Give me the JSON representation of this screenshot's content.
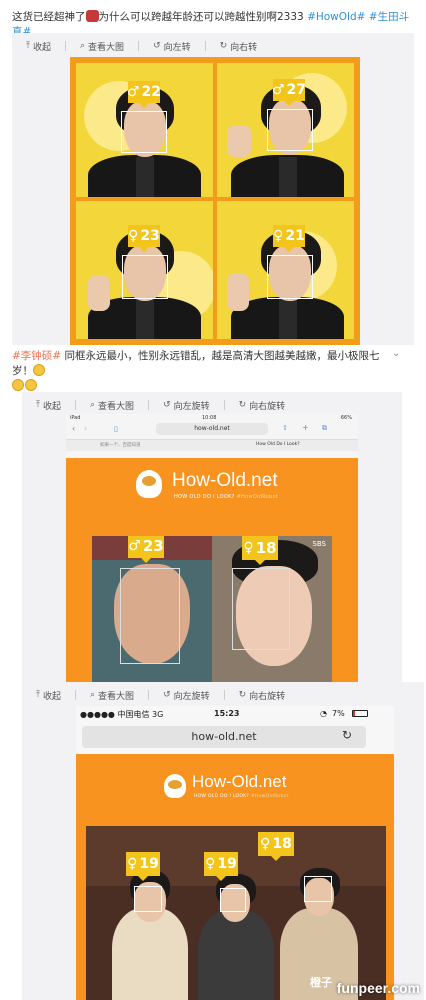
{
  "post1": {
    "text_a": "这货已经超神了",
    "text_b": "为什么可以跨越年龄还可以跨越性别啊2333 ",
    "tag1": "#HowOld#",
    "tag2": "#生田斗真#"
  },
  "toolbar1": {
    "collapse": "收起",
    "view_large": "查看大图",
    "rotate_left": "向左转",
    "rotate_right": "向右转"
  },
  "grid_ages": [
    "22",
    "27",
    "23",
    "21"
  ],
  "post2": {
    "tag": "#李钟硕#",
    "text": " 同框永远最小，性别永远错乱，越是高清大图越美越嫩，最小极限七岁！"
  },
  "toolbar2": {
    "collapse": "收起",
    "view_large": "查看大图",
    "rotate_left": "向左旋转",
    "rotate_right": "向右旋转"
  },
  "ipad": {
    "status_left": "iPad",
    "time": "10:08",
    "battery": "66%",
    "url": "how-old.net",
    "tab_left": "如果一个、百度知道",
    "tab_right": "How Old Do I Look?"
  },
  "site": {
    "title": "How-Old.net",
    "subtitle": "HOW OLD DO I LOOK?",
    "hashtag": "#HowOldRobot"
  },
  "shot2_ages": [
    "23",
    "18"
  ],
  "shot2_corner": "SBS",
  "toolbar3": {
    "collapse": "收起",
    "view_large": "查看大图",
    "rotate_left": "向左旋转",
    "rotate_right": "向右旋转"
  },
  "phone": {
    "carrier": "●●●●● 中国电信  3G",
    "time": "15:23",
    "battery": "7%",
    "url": "how-old.net"
  },
  "shot3_ages": [
    "19",
    "19",
    "18"
  ],
  "watermark": "funpeer.com",
  "corner_mark": "橙子"
}
